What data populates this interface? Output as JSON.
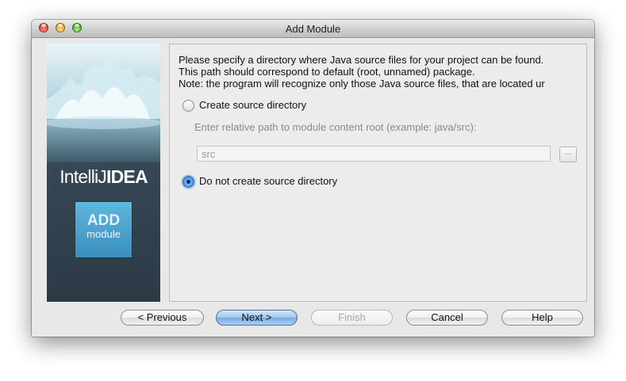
{
  "window": {
    "title": "Add Module"
  },
  "banner": {
    "brand_light": "IntelliJ",
    "brand_bold": "IDEA",
    "badge_top": "ADD",
    "badge_bottom": "module"
  },
  "description": {
    "line1": "Please specify a directory where Java source files for your project can be found.",
    "line2": "This path should correspond to default (root, unnamed) package.",
    "line3": "Note: the program will recognize only those Java source files, that are located ur"
  },
  "options": {
    "create_label": "Create source directory",
    "create_selected": false,
    "hint": "Enter relative path to module content root  (example: java/src):",
    "path_value": "src",
    "browse_label": "...",
    "skip_label": "Do not create source directory",
    "skip_selected": true
  },
  "buttons": {
    "previous": "< Previous",
    "next": "Next >",
    "finish": "Finish",
    "cancel": "Cancel",
    "help": "Help"
  },
  "colors": {
    "default_button": "#9fc6ef",
    "banner_bg": "#34444f",
    "badge_bg": "#4ba6d3"
  }
}
